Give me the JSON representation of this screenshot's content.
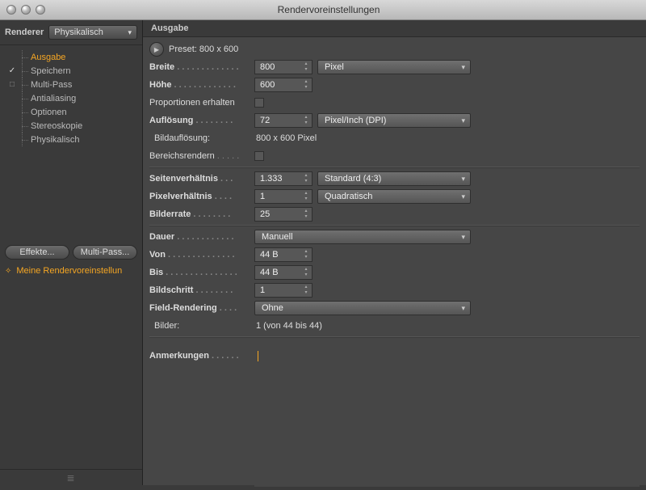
{
  "window": {
    "title": "Rendervoreinstellungen"
  },
  "sidebar": {
    "renderer_label": "Renderer",
    "renderer_value": "Physikalisch",
    "items": [
      {
        "label": "Ausgabe",
        "checked": "",
        "selected": true
      },
      {
        "label": "Speichern",
        "checked": "✓",
        "selected": false
      },
      {
        "label": "Multi-Pass",
        "checked": "□",
        "selected": false
      },
      {
        "label": "Antialiasing",
        "checked": "",
        "selected": false
      },
      {
        "label": "Optionen",
        "checked": "",
        "selected": false
      },
      {
        "label": "Stereoskopie",
        "checked": "",
        "selected": false
      },
      {
        "label": "Physikalisch",
        "checked": "",
        "selected": false
      }
    ],
    "effects_btn": "Effekte...",
    "multipass_btn": "Multi-Pass...",
    "setting_name": "Meine Rendervoreinstellun"
  },
  "panel": {
    "title": "Ausgabe",
    "preset": "Preset: 800 x 600",
    "rows": {
      "breite": {
        "label": "Breite",
        "value": "800",
        "unit": "Pixel"
      },
      "hoehe": {
        "label": "Höhe",
        "value": "600"
      },
      "proportionen": {
        "label": "Proportionen erhalten"
      },
      "aufloesung": {
        "label": "Auflösung",
        "value": "72",
        "unit": "Pixel/Inch (DPI)"
      },
      "bildaufloesung": {
        "label": "Bildauflösung:",
        "value": "800 x 600 Pixel"
      },
      "bereichsrendern": {
        "label": "Bereichsrendern"
      },
      "seitenverhaeltnis": {
        "label": "Seitenverhältnis",
        "value": "1.333",
        "preset": "Standard (4:3)"
      },
      "pixelverhaeltnis": {
        "label": "Pixelverhältnis",
        "value": "1",
        "preset": "Quadratisch"
      },
      "bilderrate": {
        "label": "Bilderrate",
        "value": "25"
      },
      "dauer": {
        "label": "Dauer",
        "value": "Manuell"
      },
      "von": {
        "label": "Von",
        "value": "44 B"
      },
      "bis": {
        "label": "Bis",
        "value": "44 B"
      },
      "bildschritt": {
        "label": "Bildschritt",
        "value": "1"
      },
      "fieldrendering": {
        "label": "Field-Rendering",
        "value": "Ohne"
      },
      "bilder": {
        "label": "Bilder:",
        "value": "1 (von 44 bis 44)"
      },
      "anmerkungen": {
        "label": "Anmerkungen"
      }
    }
  }
}
